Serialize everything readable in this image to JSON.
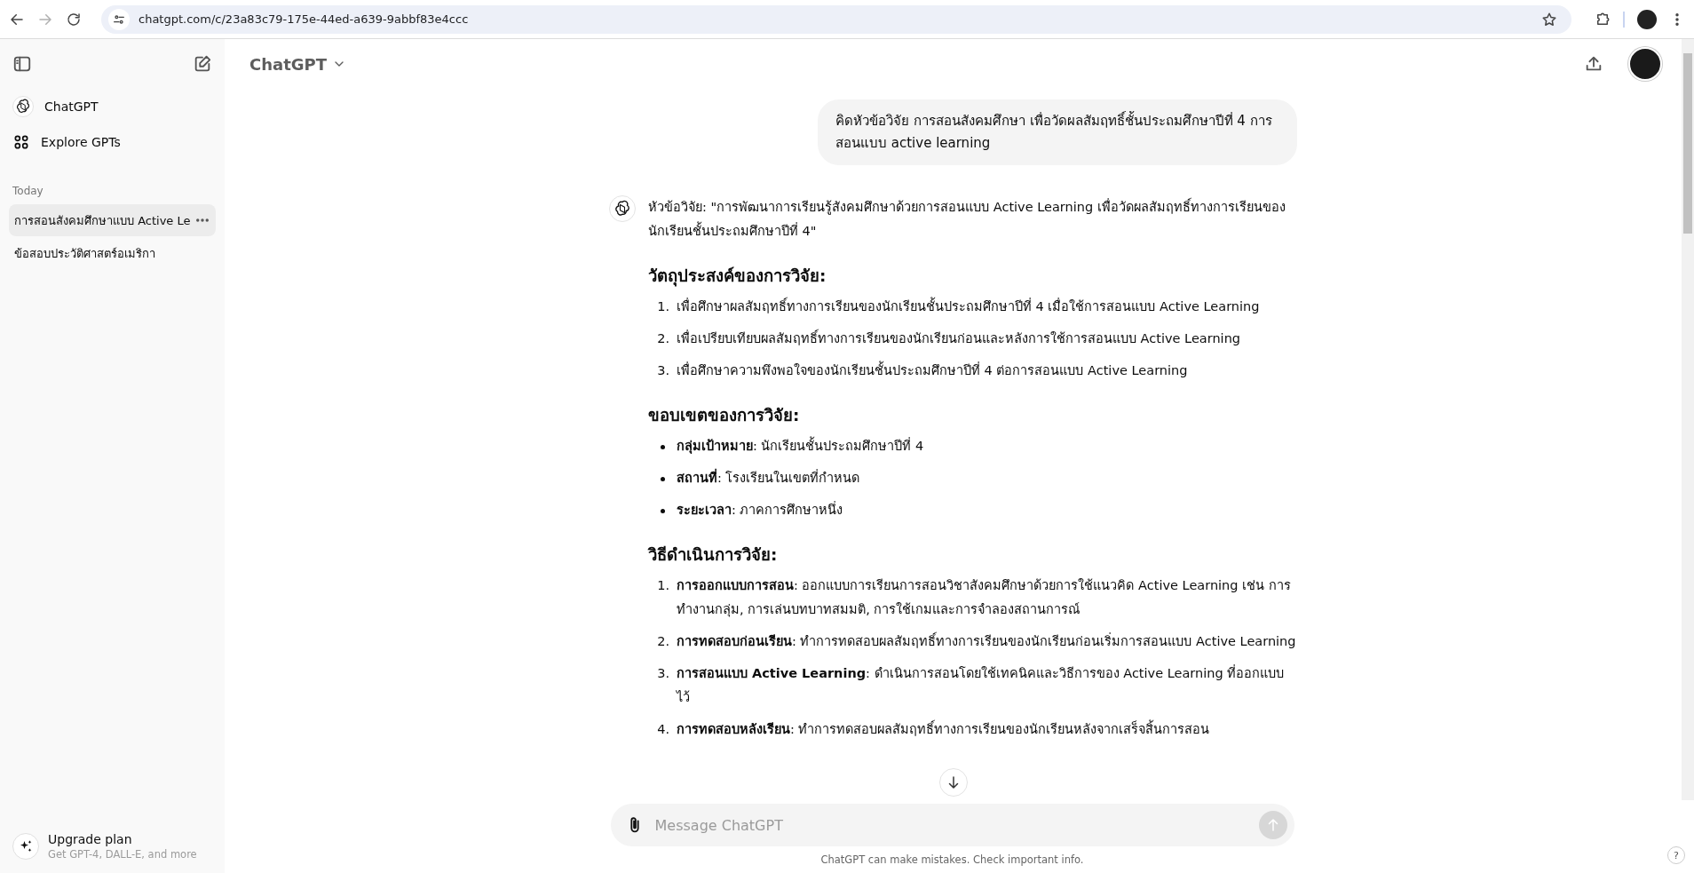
{
  "browser": {
    "url": "chatgpt.com/c/23a83c79-175e-44ed-a639-9abbf83e4ccc"
  },
  "sidebar": {
    "nav": [
      {
        "label": "ChatGPT",
        "kind": "logo"
      },
      {
        "label": "Explore GPTs",
        "kind": "grid"
      }
    ],
    "section_label": "Today",
    "chats": [
      {
        "title": "การสอนสังคมศึกษาแบบ Active Le",
        "selected": true
      },
      {
        "title": "ข้อสอบประวัติศาสตร์อเมริกา",
        "selected": false
      }
    ],
    "upgrade": {
      "title": "Upgrade plan",
      "subtitle": "Get GPT-4, DALL-E, and more"
    }
  },
  "header": {
    "model": "ChatGPT"
  },
  "conversation": {
    "user_message": "คิดหัวข้อวิจัย การสอนสังคมศึกษา เพื่อวัดผลสัมฤทธิ์ชั้นประถมศึกษาปีที่ 4 การสอนแบบ active learning",
    "intro": "หัวข้อวิจัย: \"การพัฒนาการเรียนรู้สังคมศึกษาด้วยการสอนแบบ Active Learning เพื่อวัดผลสัมฤทธิ์ทางการเรียนของนักเรียนชั้นประถมศึกษาปีที่ 4\"",
    "sections": [
      {
        "heading": "วัตถุประสงค์ของการวิจัย:",
        "kind": "ordered",
        "items": [
          {
            "marker": "1.",
            "text": "เพื่อศึกษาผลสัมฤทธิ์ทางการเรียนของนักเรียนชั้นประถมศึกษาปีที่ 4 เมื่อใช้การสอนแบบ Active Learning"
          },
          {
            "marker": "2.",
            "text": "เพื่อเปรียบเทียบผลสัมฤทธิ์ทางการเรียนของนักเรียนก่อนและหลังการใช้การสอนแบบ Active Learning"
          },
          {
            "marker": "3.",
            "text": "เพื่อศึกษาความพึงพอใจของนักเรียนชั้นประถมศึกษาปีที่ 4 ต่อการสอนแบบ Active Learning"
          }
        ]
      },
      {
        "heading": "ขอบเขตของการวิจัย:",
        "kind": "bullet",
        "items": [
          {
            "text": "**กลุ่มเป้าหมาย**: นักเรียนชั้นประถมศึกษาปีที่ 4"
          },
          {
            "text": "**สถานที่**: โรงเรียนในเขตที่กำหนด"
          },
          {
            "text": "**ระยะเวลา**: ภาคการศึกษาหนึ่ง"
          }
        ]
      },
      {
        "heading": "วิธีดำเนินการวิจัย:",
        "kind": "ordered",
        "items": [
          {
            "marker": "1.",
            "text": "**การออกแบบการสอน**: ออกแบบการเรียนการสอนวิชาสังคมศึกษาด้วยการใช้แนวคิด Active Learning เช่น การทำงานกลุ่ม, การเล่นบทบาทสมมติ, การใช้เกมและการจำลองสถานการณ์"
          },
          {
            "marker": "2.",
            "text": "**การทดสอบก่อนเรียน**: ทำการทดสอบผลสัมฤทธิ์ทางการเรียนของนักเรียนก่อนเริ่มการสอนแบบ Active Learning"
          },
          {
            "marker": "3.",
            "text": "**การสอนแบบ Active Learning**: ดำเนินการสอนโดยใช้เทคนิคและวิธีการของ Active Learning ที่ออกแบบไว้"
          },
          {
            "marker": "4.",
            "text": "**การทดสอบหลังเรียน**: ทำการทดสอบผลสัมฤทธิ์ทางการเรียนของนักเรียนหลังจากเสร็จสิ้นการสอน"
          }
        ]
      }
    ]
  },
  "composer": {
    "placeholder": "Message ChatGPT",
    "disclaimer": "ChatGPT can make mistakes. Check important info.",
    "send_disabled": true
  },
  "help_label": "?"
}
